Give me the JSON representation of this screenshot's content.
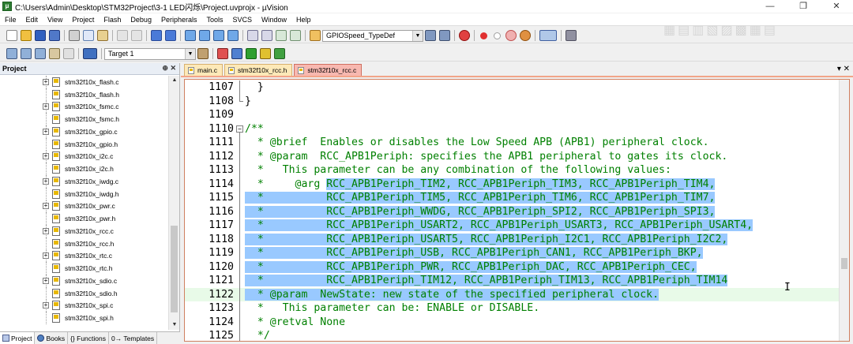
{
  "window": {
    "title": "C:\\Users\\Admin\\Desktop\\STM32Project\\3-1 LED闪烁\\Project.uvprojx - µVision",
    "controls": [
      "—",
      "❐",
      "✕"
    ]
  },
  "menu": [
    "File",
    "Edit",
    "View",
    "Project",
    "Flash",
    "Debug",
    "Peripherals",
    "Tools",
    "SVCS",
    "Window",
    "Help"
  ],
  "toolbar": {
    "find_combo_value": "GPIOSpeed_TypeDef",
    "target_combo_value": "Target 1"
  },
  "project_panel": {
    "title": "Project",
    "header_icons": "⊕ ✕",
    "files": [
      {
        "name": "stm32f10x_flash.c",
        "expandable": true
      },
      {
        "name": "stm32f10x_flash.h",
        "expandable": false
      },
      {
        "name": "stm32f10x_fsmc.c",
        "expandable": true
      },
      {
        "name": "stm32f10x_fsmc.h",
        "expandable": false
      },
      {
        "name": "stm32f10x_gpio.c",
        "expandable": true
      },
      {
        "name": "stm32f10x_gpio.h",
        "expandable": false
      },
      {
        "name": "stm32f10x_i2c.c",
        "expandable": true
      },
      {
        "name": "stm32f10x_i2c.h",
        "expandable": false
      },
      {
        "name": "stm32f10x_iwdg.c",
        "expandable": true
      },
      {
        "name": "stm32f10x_iwdg.h",
        "expandable": false
      },
      {
        "name": "stm32f10x_pwr.c",
        "expandable": true
      },
      {
        "name": "stm32f10x_pwr.h",
        "expandable": false
      },
      {
        "name": "stm32f10x_rcc.c",
        "expandable": true
      },
      {
        "name": "stm32f10x_rcc.h",
        "expandable": false
      },
      {
        "name": "stm32f10x_rtc.c",
        "expandable": true
      },
      {
        "name": "stm32f10x_rtc.h",
        "expandable": false
      },
      {
        "name": "stm32f10x_sdio.c",
        "expandable": true
      },
      {
        "name": "stm32f10x_sdio.h",
        "expandable": false
      },
      {
        "name": "stm32f10x_spi.c",
        "expandable": true
      },
      {
        "name": "stm32f10x_spi.h",
        "expandable": false
      }
    ],
    "bottom_tabs": [
      "Project",
      "Books",
      "{} Functions",
      "0→ Templates"
    ]
  },
  "editor": {
    "tabs": [
      {
        "label": "main.c",
        "active": false
      },
      {
        "label": "stm32f10x_rcc.h",
        "active": false
      },
      {
        "label": "stm32f10x_rcc.c",
        "active": true
      }
    ],
    "tab_controls": "▾ ✕",
    "lines": [
      {
        "num": "1107",
        "pre": "  }",
        "hl": "",
        "post": "",
        "fold": "bar",
        "plain": true
      },
      {
        "num": "1108",
        "pre": "}",
        "hl": "",
        "post": "",
        "fold": "end",
        "plain": true
      },
      {
        "num": "1109",
        "pre": "",
        "hl": "",
        "post": "",
        "fold": "",
        "plain": true
      },
      {
        "num": "1110",
        "pre": "/**",
        "hl": "",
        "post": "",
        "fold": "box",
        "plain": false
      },
      {
        "num": "1111",
        "pre": "  * @brief  Enables or disables the Low Speed APB (APB1) peripheral clock.",
        "hl": "",
        "post": "",
        "fold": "bar",
        "plain": false
      },
      {
        "num": "1112",
        "pre": "  * @param  RCC_APB1Periph: specifies the APB1 peripheral to gates its clock.",
        "hl": "",
        "post": "",
        "fold": "bar",
        "plain": false
      },
      {
        "num": "1113",
        "pre": "  *   This parameter can be any combination of the following values:",
        "hl": "",
        "post": "",
        "fold": "bar",
        "plain": false
      },
      {
        "num": "1114",
        "pre": "  *     @arg ",
        "hl": "RCC_APB1Periph_TIM2, RCC_APB1Periph_TIM3, RCC_APB1Periph_TIM4,",
        "post": "",
        "fold": "bar",
        "plain": false
      },
      {
        "num": "1115",
        "pre": "",
        "hl": "  *          RCC_APB1Periph_TIM5, RCC_APB1Periph_TIM6, RCC_APB1Periph_TIM7,",
        "post": "",
        "fold": "bar",
        "plain": false
      },
      {
        "num": "1116",
        "pre": "",
        "hl": "  *          RCC_APB1Periph_WWDG, RCC_APB1Periph_SPI2, RCC_APB1Periph_SPI3,",
        "post": "",
        "fold": "bar",
        "plain": false
      },
      {
        "num": "1117",
        "pre": "",
        "hl": "  *          RCC_APB1Periph_USART2, RCC_APB1Periph_USART3, RCC_APB1Periph_USART4,",
        "post": "",
        "fold": "bar",
        "plain": false
      },
      {
        "num": "1118",
        "pre": "",
        "hl": "  *          RCC_APB1Periph_USART5, RCC_APB1Periph_I2C1, RCC_APB1Periph_I2C2,",
        "post": "",
        "fold": "bar",
        "plain": false
      },
      {
        "num": "1119",
        "pre": "",
        "hl": "  *          RCC_APB1Periph_USB, RCC_APB1Periph_CAN1, RCC_APB1Periph_BKP,",
        "post": "",
        "fold": "bar",
        "plain": false
      },
      {
        "num": "1120",
        "pre": "",
        "hl": "  *          RCC_APB1Periph_PWR, RCC_APB1Periph_DAC, RCC_APB1Periph_CEC,",
        "post": "",
        "fold": "bar",
        "plain": false
      },
      {
        "num": "1121",
        "pre": "",
        "hl": "  *          RCC_APB1Periph_TIM12, RCC_APB1Periph_TIM13, RCC_APB1Periph_TIM14",
        "post": "",
        "fold": "bar",
        "plain": false
      },
      {
        "num": "1122",
        "pre": "",
        "hl": "  * @param  NewState: new state of the specified peripheral clock.",
        "post": "",
        "fold": "bar",
        "plain": false,
        "current": true
      },
      {
        "num": "1123",
        "pre": "  *   This parameter can be: ENABLE or DISABLE.",
        "hl": "",
        "post": "",
        "fold": "bar",
        "plain": false
      },
      {
        "num": "1124",
        "pre": "  * @retval None",
        "hl": "",
        "post": "",
        "fold": "bar",
        "plain": false
      },
      {
        "num": "1125",
        "pre": "  */",
        "hl": "",
        "post": "",
        "fold": "bar",
        "plain": false
      }
    ]
  },
  "colors": {
    "comment": "#008000",
    "selection": "#99c9ff",
    "tab_active": "#f8b8b0",
    "tab_inactive": "#fde9b8",
    "current_line": "#e8fae8"
  }
}
